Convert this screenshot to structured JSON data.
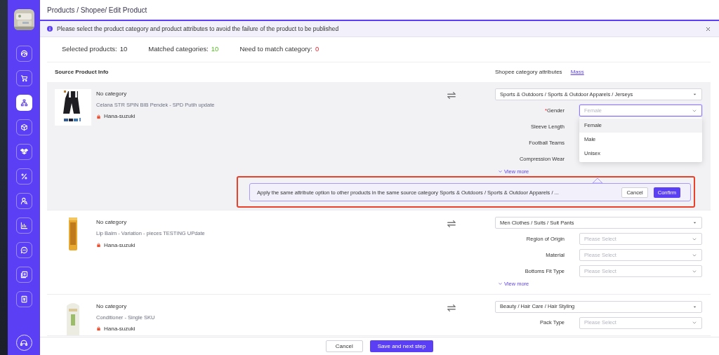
{
  "breadcrumb": "Products / Shopee/ Edit Product",
  "sidebar": {
    "items": [
      {
        "selected": false
      },
      {
        "selected": false
      },
      {
        "selected": true
      },
      {
        "selected": false
      },
      {
        "selected": false
      },
      {
        "selected": false
      },
      {
        "selected": false
      },
      {
        "selected": false
      },
      {
        "selected": false
      },
      {
        "selected": false
      },
      {
        "selected": false
      }
    ]
  },
  "notice": "Please select the product category and product attributes to avoid the failure of the product to be published",
  "stats": [
    {
      "kind": "total",
      "label": "Selected products:",
      "value": "10"
    },
    {
      "kind": "matched",
      "label": "Matched categories:",
      "value": "10"
    },
    {
      "kind": "unmatched",
      "label": "Need to match category:",
      "value": "0"
    }
  ],
  "columns": {
    "source": "Source Product Info",
    "target": "Shopee category attributes",
    "mass_link": "Mass"
  },
  "products": [
    {
      "kind": "shorts",
      "active": true,
      "status": "No category",
      "name": "Celana STR SPIN BIB Pendek - SPD Putih update",
      "shop": "Hana-suzuki",
      "category": "Sports & Outdoors / Sports & Outdoor Apparels / Jerseys",
      "attributes": [
        {
          "required_mark": "*",
          "label": "Gender",
          "value": "Female",
          "focused": true
        },
        {
          "label": "Sleeve Length"
        },
        {
          "label": "Football Teams"
        },
        {
          "label": "Compression Wear"
        }
      ],
      "view_more": "View more",
      "dropdown": {
        "options": [
          {
            "label": "Female",
            "selected": true
          },
          {
            "label": "Male",
            "selected": false
          },
          {
            "label": "Unisex",
            "selected": false
          }
        ]
      },
      "popconfirm": {
        "text": "Apply the same attribute option to other products in the same source category Sports & Outdoors / Sports & Outdoor Apparels / ...",
        "cancel": "Cancel",
        "confirm": "Confirm",
        "highlighted": true
      }
    },
    {
      "kind": "lipbalm",
      "active": false,
      "status": "No category",
      "name": "Lip Balm - Variation - pieces TESTING UPdate",
      "shop": "Hana-suzuki",
      "category": "Men Clothes / Suits / Suit Pants",
      "attributes": [
        {
          "label": "Region of Origin",
          "placeholder": "Please Select"
        },
        {
          "label": "Material",
          "placeholder": "Please Select"
        },
        {
          "label": "Bottoms Fit Type",
          "placeholder": "Please Select"
        }
      ],
      "view_more": "View more"
    },
    {
      "kind": "bottle",
      "active": false,
      "status": "No category",
      "name": "Conditioner - Single SKU",
      "shop": "Hana-suzuki",
      "category": "Beauty / Hair Care / Hair Styling",
      "attributes": [
        {
          "label": "Pack Type",
          "placeholder": "Please Select"
        }
      ]
    }
  ],
  "footer": {
    "cancel": "Cancel",
    "save": "Save and next step"
  }
}
